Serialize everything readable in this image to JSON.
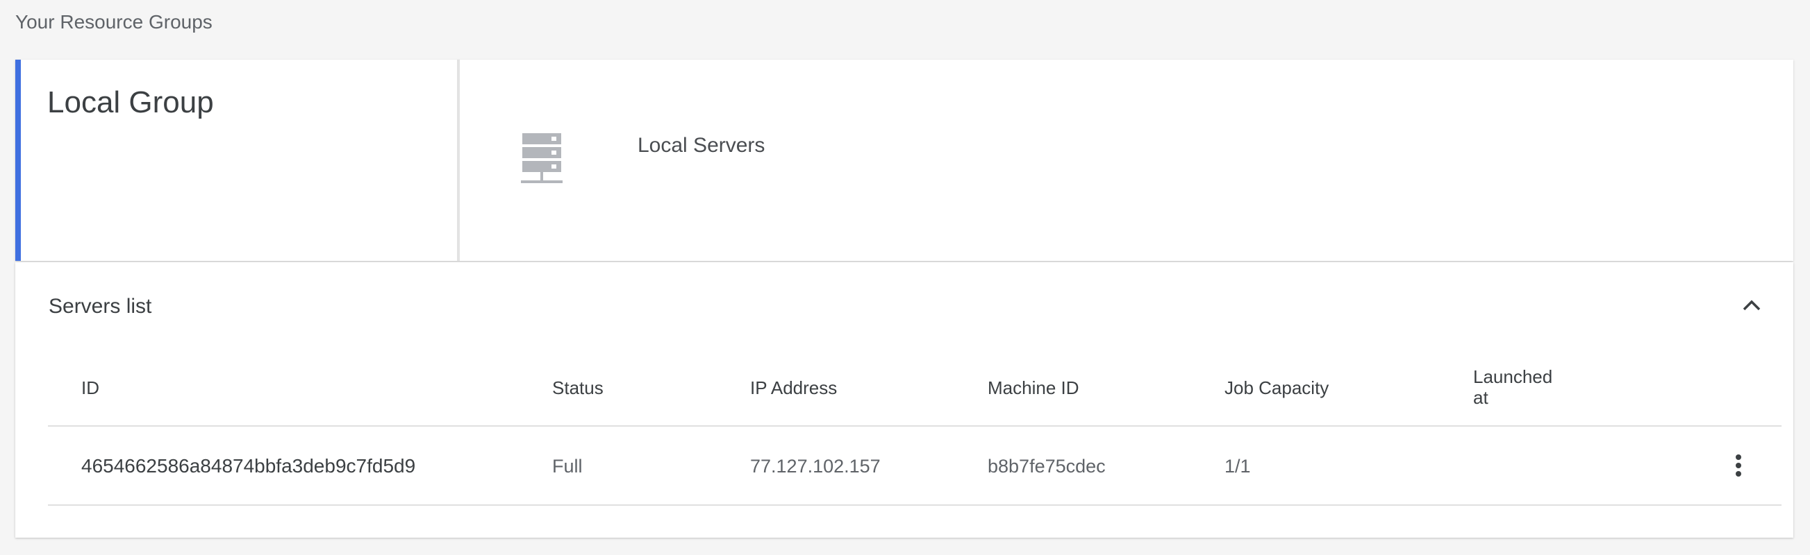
{
  "page": {
    "title": "Your Resource Groups"
  },
  "group": {
    "name": "Local Group",
    "accent_color": "#3f6fe0",
    "server_type_icon": "server-rack-icon",
    "server_type_label": "Local Servers"
  },
  "servers_list": {
    "title": "Servers list",
    "collapse_icon": "chevron-up-icon",
    "columns": [
      "ID",
      "Status",
      "IP Address",
      "Machine ID",
      "Job Capacity",
      "Launched at"
    ],
    "rows": [
      {
        "id": "4654662586a84874bbfa3deb9c7fd5d9",
        "status": "Full",
        "ip_address": "77.127.102.157",
        "machine_id": "b8b7fe75cdec",
        "job_capacity": "1/1",
        "launched_at": "",
        "menu_icon": "more-vert-icon"
      }
    ]
  }
}
